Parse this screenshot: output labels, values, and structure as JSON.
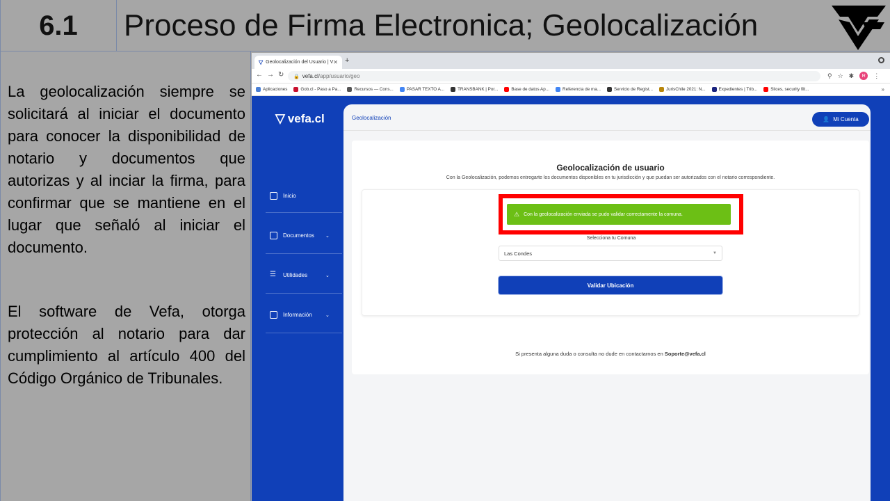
{
  "slide": {
    "number": "6.1",
    "title": "Proceso de Firma Electronica; Geolocalización",
    "paragraph1": "La geolocalización siempre se solicitará al iniciar el documento para conocer la disponibilidad de notario y documentos que autorizas y al inciar la firma, para confirmar que se mantiene en el lugar que señaló al iniciar el documento.",
    "paragraph2": "El software de Vefa, otorga protección al notario para dar cumplimiento al artículo 400 del Código Orgánico de Tribunales."
  },
  "browser": {
    "tab_title": "Geolocalización del Usuario | V",
    "url_domain": "vefa.cl",
    "url_path": "/app/usuario/geo",
    "bookmarks": [
      {
        "label": "Aplicaciones",
        "color": "#4a7fd6"
      },
      {
        "label": "Gob.cl - Paso a Pa...",
        "color": "#c8102e"
      },
      {
        "label": "Recursos — Cons...",
        "color": "#555555"
      },
      {
        "label": "PASAR TEXTO A...",
        "color": "#4285f4"
      },
      {
        "label": "TRANSBANK | Por...",
        "color": "#333333"
      },
      {
        "label": "Base de datos Ap...",
        "color": "#ff0000"
      },
      {
        "label": "Referencia de ma...",
        "color": "#4285f4"
      },
      {
        "label": "Servicio de Regist...",
        "color": "#333333"
      },
      {
        "label": "JurisChile 2021: N...",
        "color": "#b8860b"
      },
      {
        "label": "Expedientes | Trib...",
        "color": "#1a237e"
      },
      {
        "label": "Slices, security filt...",
        "color": "#ff0000"
      }
    ]
  },
  "app": {
    "brand": "vefa.cl",
    "nav": {
      "inicio": "Inicio",
      "documentos": "Documentos",
      "utilidades": "Utilidades",
      "informacion": "Información"
    },
    "breadcrumb": "Geolocalización",
    "account_button": "Mi Cuenta",
    "card_title": "Geolocalización de usuario",
    "card_subtitle": "Con la Geolocalización, podemos entregarte los documentos disponibles en tu jurisdicción y que puedan ser autorizados con el notario correspondiente.",
    "alert_text": "Con la geolocalización enviada se pudo validar correctamente la comuna.",
    "select_label": "Selecciona tu Comuna",
    "select_value": "Las Condes",
    "validate_button": "Validar Ubicación",
    "footer_text": "Si presenta alguna duda o consulta no dude en contactarnos en",
    "footer_email": "Soporte@vefa.cl"
  },
  "colors": {
    "slide_bg": "#a6a6a6",
    "brand_blue": "#1040b8",
    "alert_green": "#6cbf15",
    "highlight_red": "#ff0000"
  }
}
